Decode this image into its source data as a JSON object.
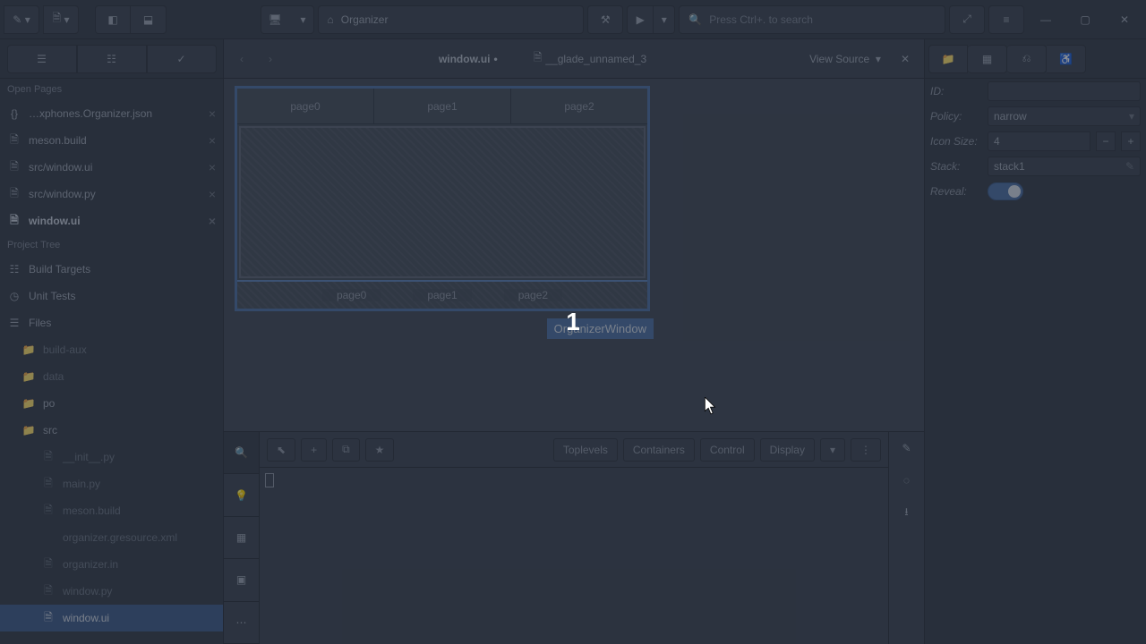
{
  "topbar": {
    "project_label": "Organizer",
    "search_placeholder": "Press Ctrl+. to search"
  },
  "open_pages": {
    "header": "Open Pages",
    "items": [
      {
        "label": "…xphones.Organizer.json",
        "active": false,
        "icon": "braces"
      },
      {
        "label": "meson.build",
        "active": false,
        "icon": "file"
      },
      {
        "label": "src/window.ui",
        "active": false,
        "icon": "file"
      },
      {
        "label": "src/window.py",
        "active": false,
        "icon": "file"
      },
      {
        "label": "window.ui",
        "active": true,
        "icon": "file"
      }
    ]
  },
  "project_tree": {
    "header": "Project Tree",
    "items": [
      {
        "label": "Build Targets",
        "depth": 0,
        "icon": "target",
        "muted": false
      },
      {
        "label": "Unit Tests",
        "depth": 0,
        "icon": "clock",
        "muted": false
      },
      {
        "label": "Files",
        "depth": 0,
        "icon": "list",
        "muted": false
      },
      {
        "label": "build-aux",
        "depth": 1,
        "icon": "folder",
        "muted": true
      },
      {
        "label": "data",
        "depth": 1,
        "icon": "folder",
        "muted": true
      },
      {
        "label": "po",
        "depth": 1,
        "icon": "folder",
        "muted": false
      },
      {
        "label": "src",
        "depth": 1,
        "icon": "folder",
        "muted": false
      },
      {
        "label": "__init__.py",
        "depth": 2,
        "icon": "file",
        "muted": true
      },
      {
        "label": "main.py",
        "depth": 2,
        "icon": "file",
        "muted": true
      },
      {
        "label": "meson.build",
        "depth": 2,
        "icon": "file",
        "muted": true
      },
      {
        "label": "organizer.gresource.xml",
        "depth": 2,
        "icon": "code",
        "muted": true
      },
      {
        "label": "organizer.in",
        "depth": 2,
        "icon": "file",
        "muted": true
      },
      {
        "label": "window.py",
        "depth": 2,
        "icon": "file",
        "muted": true
      },
      {
        "label": "window.ui",
        "depth": 2,
        "icon": "file",
        "muted": false,
        "selected": true
      }
    ]
  },
  "tabs": {
    "active": {
      "label": "window.ui",
      "dirty": "•"
    },
    "other": {
      "label": "__glade_unnamed_3"
    },
    "view_source": "View Source"
  },
  "canvas": {
    "tabs": [
      "page0",
      "page1",
      "page2"
    ],
    "stack_pages": [
      "page0",
      "page1",
      "page2"
    ],
    "badge": "OrganizerWindow"
  },
  "bottom": {
    "categories": [
      "Toplevels",
      "Containers",
      "Control",
      "Display"
    ]
  },
  "props": {
    "id_label": "ID:",
    "id_value": "",
    "policy_label": "Policy:",
    "policy_value": "narrow",
    "icon_label": "Icon Size:",
    "icon_value": "4",
    "stack_label": "Stack:",
    "stack_value": "stack1",
    "reveal_label": "Reveal:"
  },
  "overlay_number": "1"
}
